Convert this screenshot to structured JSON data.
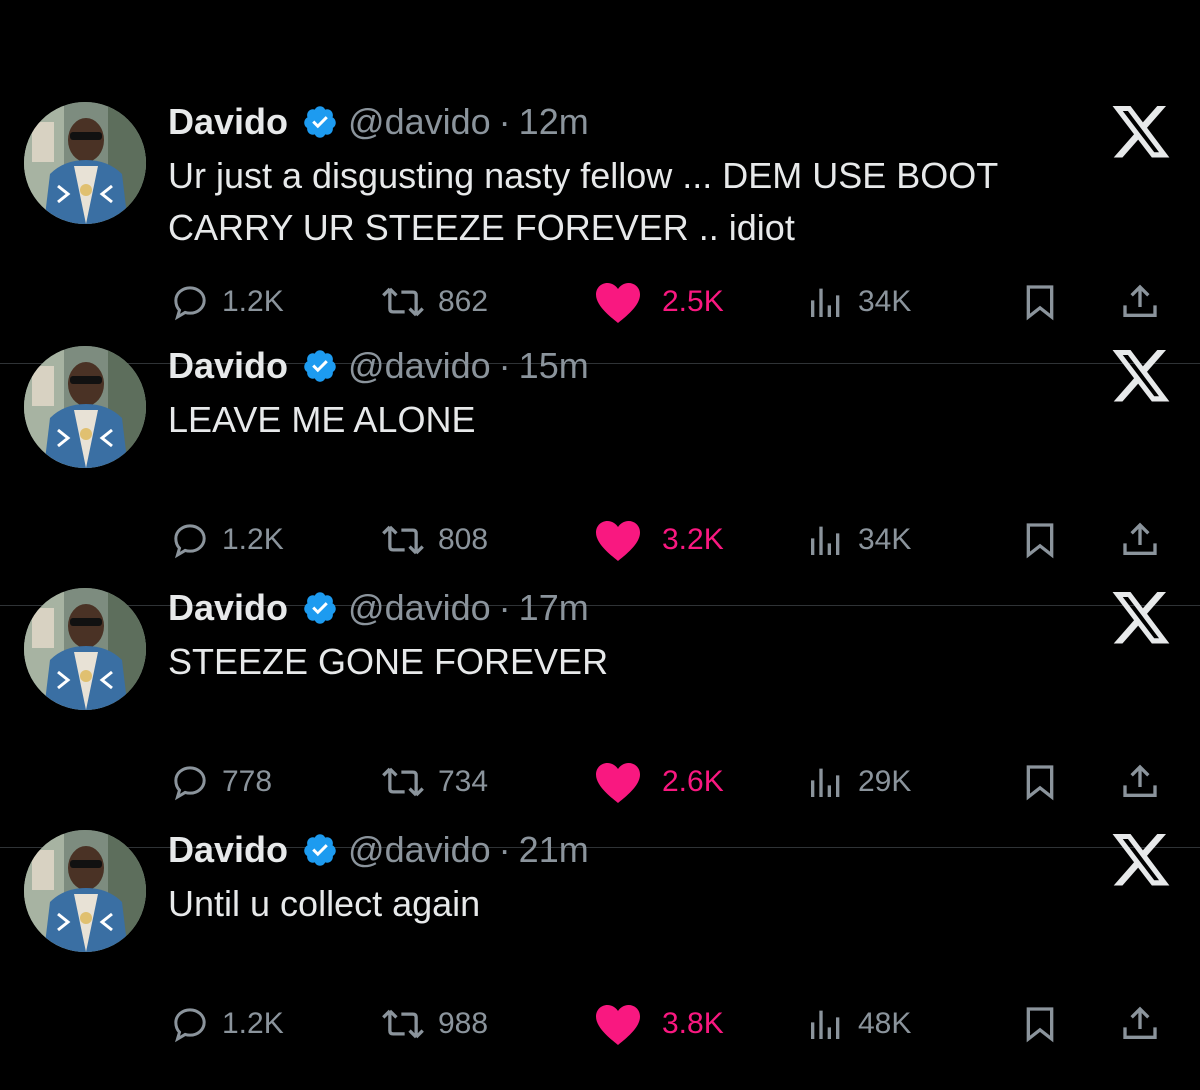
{
  "colors": {
    "background": "#000000",
    "text": "#e7e9ea",
    "muted": "#8b949c",
    "like": "#f91880",
    "verified": "#1d9bf0",
    "divider": "#2f3336"
  },
  "icons": {
    "reply": "reply-icon",
    "retweet": "retweet-icon",
    "like": "heart-icon",
    "views": "views-icon",
    "bookmark": "bookmark-icon",
    "share": "share-icon",
    "brand": "x-logo-icon",
    "verified": "verified-badge-icon"
  },
  "tweets": [
    {
      "name": "Davido",
      "handle": "@davido",
      "separator": "·",
      "time": "12m",
      "text": "Ur just a disgusting nasty fellow ... DEM USE BOOT CARRY UR STEEZE FOREVER .. idiot",
      "replies": "1.2K",
      "retweets": "862",
      "likes": "2.5K",
      "views": "34K"
    },
    {
      "name": "Davido",
      "handle": "@davido",
      "separator": "·",
      "time": "15m",
      "text": "LEAVE ME ALONE",
      "replies": "1.2K",
      "retweets": "808",
      "likes": "3.2K",
      "views": "34K"
    },
    {
      "name": "Davido",
      "handle": "@davido",
      "separator": "·",
      "time": "17m",
      "text": "STEEZE GONE FOREVER",
      "replies": "778",
      "retweets": "734",
      "likes": "2.6K",
      "views": "29K"
    },
    {
      "name": "Davido",
      "handle": "@davido",
      "separator": "·",
      "time": "21m",
      "text": "Until u collect again",
      "replies": "1.2K",
      "retweets": "988",
      "likes": "3.8K",
      "views": "48K"
    }
  ]
}
